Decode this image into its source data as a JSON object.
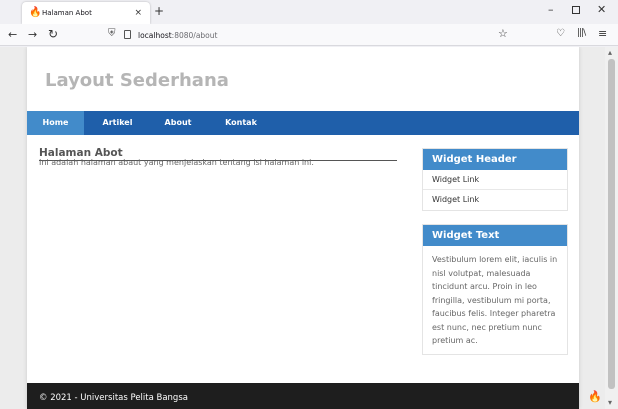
{
  "browser": {
    "tab_title": "Halaman Abot",
    "tab_close": "×",
    "new_tab": "+",
    "url_host": "localhost",
    "url_rest": ":8080/about",
    "icons": [
      "codeigniter-favicon-icon",
      "back-icon",
      "forward-icon",
      "reload-icon",
      "shield-icon",
      "page-icon",
      "star-icon",
      "pocket-icon",
      "library-icon",
      "menu-icon"
    ]
  },
  "site": {
    "title": "Layout Sederhana",
    "nav": [
      "Home",
      "Artikel",
      "About",
      "Kontak"
    ],
    "active_nav": "Home"
  },
  "article": {
    "title": "Halaman Abot",
    "body": "Ini adalah halaman abaut yang menjelaskan tentang isi halaman ini."
  },
  "sidebar": {
    "widget1": {
      "header": "Widget Header",
      "links": [
        "Widget Link",
        "Widget Link"
      ]
    },
    "widget2": {
      "header": "Widget Text",
      "text": "Vestibulum lorem elit, iaculis in nisl volutpat, malesuada tincidunt arcu. Proin in leo fringilla, vestibulum mi porta, faucibus felis. Integer pharetra est nunc, nec pretium nunc pretium ac."
    }
  },
  "footer": {
    "text": "© 2021 - Universitas Pelita Bangsa"
  },
  "colors": {
    "nav_bg": "#1f5faa",
    "nav_active": "#428bca",
    "widget_header": "#428bca",
    "footer_bg": "#1e1e1e",
    "title_gray": "#b5b5b5"
  }
}
